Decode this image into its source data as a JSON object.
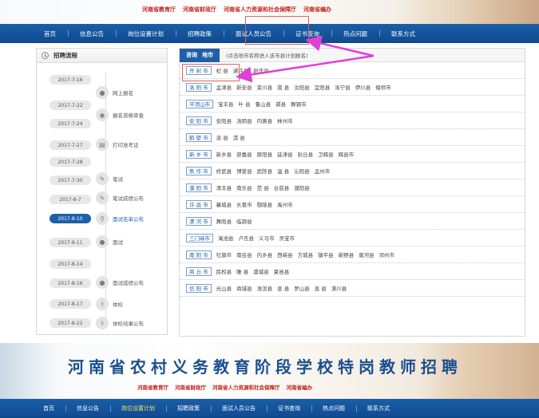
{
  "top_banner": {
    "departments": [
      "河南省教育厅",
      "河南省财政厅",
      "河南省人力资源和社会保障厅",
      "河南省编办"
    ]
  },
  "nav": {
    "items": [
      {
        "label": "首页",
        "highlight": false
      },
      {
        "label": "信息公告",
        "highlight": false
      },
      {
        "label": "岗位设置计划",
        "highlight": false
      },
      {
        "label": "招聘政策",
        "highlight": false
      },
      {
        "label": "面试人员公告",
        "highlight": false
      },
      {
        "label": "证书查询",
        "highlight": false
      },
      {
        "label": "热点问题",
        "highlight": false
      },
      {
        "label": "联系方式",
        "highlight": false
      }
    ]
  },
  "process": {
    "title": "招聘流程",
    "dates": [
      "2017-7-16",
      "2017-7-22",
      "2017-7-24",
      "2017-7-27",
      "2017-7-28",
      "2017-7-30",
      "2017-8-7",
      "2017-8-10",
      "2017-8-11",
      "2017-8-14",
      "2017-8-16",
      "2017-8-17",
      "2017-8-22"
    ],
    "active_date_index": 7,
    "steps": [
      {
        "label": "网上报名",
        "icon": "user-icon"
      },
      {
        "label": "报名资格审查",
        "icon": "eye-icon"
      },
      {
        "label": "打印准考证",
        "icon": "printer-icon"
      },
      {
        "label": "笔试",
        "icon": "pencil-icon"
      },
      {
        "label": "笔试成绩公布",
        "icon": "pencil-icon"
      },
      {
        "label": "面试名单公布",
        "icon": "search-user-icon"
      },
      {
        "label": "面试",
        "icon": "users-icon"
      },
      {
        "label": "面试成绩公布",
        "icon": "users-icon"
      },
      {
        "label": "体检",
        "icon": "stethoscope-icon"
      },
      {
        "label": "体检结果公布",
        "icon": "stethoscope-icon"
      }
    ],
    "active_step_index": 5
  },
  "cities_panel": {
    "tab_label": "咨询",
    "tab_label2": "地市",
    "hint": "(点击地市名称进入该市县计划报名)",
    "rows": [
      {
        "city": "开 封 市",
        "counties": [
          "杞 县",
          "通许县",
          "尉氏县"
        ]
      },
      {
        "city": "洛 阳 市",
        "counties": [
          "孟津县",
          "新安县",
          "栾川县",
          "嵩 县",
          "汝阳县",
          "宜阳县",
          "洛宁县",
          "伊川县",
          "偃师市"
        ]
      },
      {
        "city": "平顶山市",
        "counties": [
          "宝丰县",
          "叶 县",
          "鲁山县",
          "郏县",
          "舞钢市"
        ]
      },
      {
        "city": "安 阳 市",
        "counties": [
          "安阳县",
          "汤阴县",
          "内黄县",
          "林州市"
        ]
      },
      {
        "city": "鹤 壁 市",
        "counties": [
          "浚 县",
          "淇 县"
        ]
      },
      {
        "city": "新 乡 市",
        "counties": [
          "新乡县",
          "获嘉县",
          "原阳县",
          "延津县",
          "封丘县",
          "卫辉县",
          "辉县市"
        ]
      },
      {
        "city": "焦 作 市",
        "counties": [
          "修武县",
          "博爱县",
          "武陟县",
          "温 县",
          "沁阳县",
          "孟州市"
        ]
      },
      {
        "city": "濮 阳 市",
        "counties": [
          "清丰县",
          "南乐县",
          "范 县",
          "台前县",
          "濮阳县"
        ]
      },
      {
        "city": "许 昌 市",
        "counties": [
          "襄城县",
          "长葛市",
          "鄢陵县",
          "禹州市"
        ]
      },
      {
        "city": "漯 河 市",
        "counties": [
          "舞阳县",
          "临颍县"
        ]
      },
      {
        "city": "三门峡市",
        "counties": [
          "渑池县",
          "卢氏县",
          "义马市",
          "灵宝市"
        ]
      },
      {
        "city": "南 阳 市",
        "counties": [
          "社旗市",
          "南召县",
          "内乡县",
          "西峡县",
          "方城县",
          "镇平县",
          "新野县",
          "唐河县",
          "邓州市"
        ]
      },
      {
        "city": "商 丘 市",
        "counties": [
          "民权县",
          "睢 县",
          "虞城县",
          "夏邑县"
        ]
      },
      {
        "city": "信 阳 市",
        "counties": [
          "光山县",
          "商城县",
          "淮滨县",
          "息 县",
          "罗山县",
          "息 县",
          "潢川县"
        ]
      }
    ]
  },
  "bottom_banner": {
    "title": "河南省农村义务教育阶段学校特岗教师招聘",
    "departments": [
      "河南省教育厅",
      "河南省财政厅",
      "河南省人力资源和社会保障厅",
      "河南省编办"
    ]
  },
  "nav2": {
    "items": [
      {
        "label": "首页",
        "highlight": false
      },
      {
        "label": "信息公告",
        "highlight": false
      },
      {
        "label": "岗位设置计划",
        "highlight": true
      },
      {
        "label": "招聘政策",
        "highlight": false
      },
      {
        "label": "面试人员公告",
        "highlight": false
      },
      {
        "label": "证书查询",
        "highlight": false
      },
      {
        "label": "热点问题",
        "highlight": false
      },
      {
        "label": "联系方式",
        "highlight": false
      }
    ]
  },
  "annotation_color": "#e040d8"
}
